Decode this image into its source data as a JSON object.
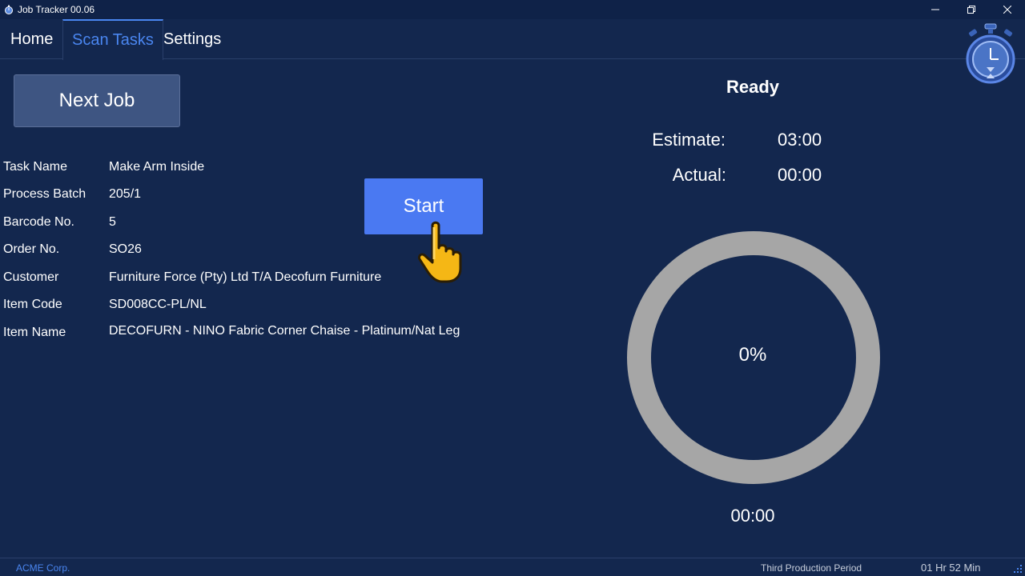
{
  "window": {
    "title": "Job Tracker 00.06",
    "icon": "stopwatch-icon",
    "controls": [
      "minimize-icon",
      "restore-icon",
      "close-icon"
    ]
  },
  "tabs": [
    {
      "label": "Home",
      "active": false
    },
    {
      "label": "Scan Tasks",
      "active": true
    },
    {
      "label": "Settings",
      "active": false
    }
  ],
  "logo": "stopwatch-logo-icon",
  "actions": {
    "next_job_label": "Next Job",
    "start_label": "Start"
  },
  "job": {
    "fields": [
      {
        "label": "Task Name",
        "value": "Make Arm Inside"
      },
      {
        "label": "Process Batch",
        "value": "205/1"
      },
      {
        "label": "Barcode No.",
        "value": "5"
      },
      {
        "label": "Order No.",
        "value": "SO26"
      },
      {
        "label": "Customer",
        "value": "Furniture Force (Pty) Ltd T/A Decofurn Furniture"
      },
      {
        "label": "Item Code",
        "value": "SD008CC-PL/NL"
      },
      {
        "label": "Item Name",
        "value": "DECOFURN - NINO Fabric Corner Chaise - Platinum/Nat Leg"
      }
    ]
  },
  "timer": {
    "status": "Ready",
    "estimate_label": "Estimate:",
    "estimate_value": "03:00",
    "actual_label": "Actual:",
    "actual_value": "00:00",
    "progress_percent_text": "0%",
    "progress": 0,
    "elapsed": "00:00"
  },
  "statusbar": {
    "company": "ACME Corp.",
    "period": "Third Production Period",
    "duration": "01 Hr 52 Min"
  },
  "colors": {
    "background": "#13274e",
    "accent": "#4a86f0",
    "start_button": "#4a79f2",
    "ring": "#a6a6a6"
  }
}
